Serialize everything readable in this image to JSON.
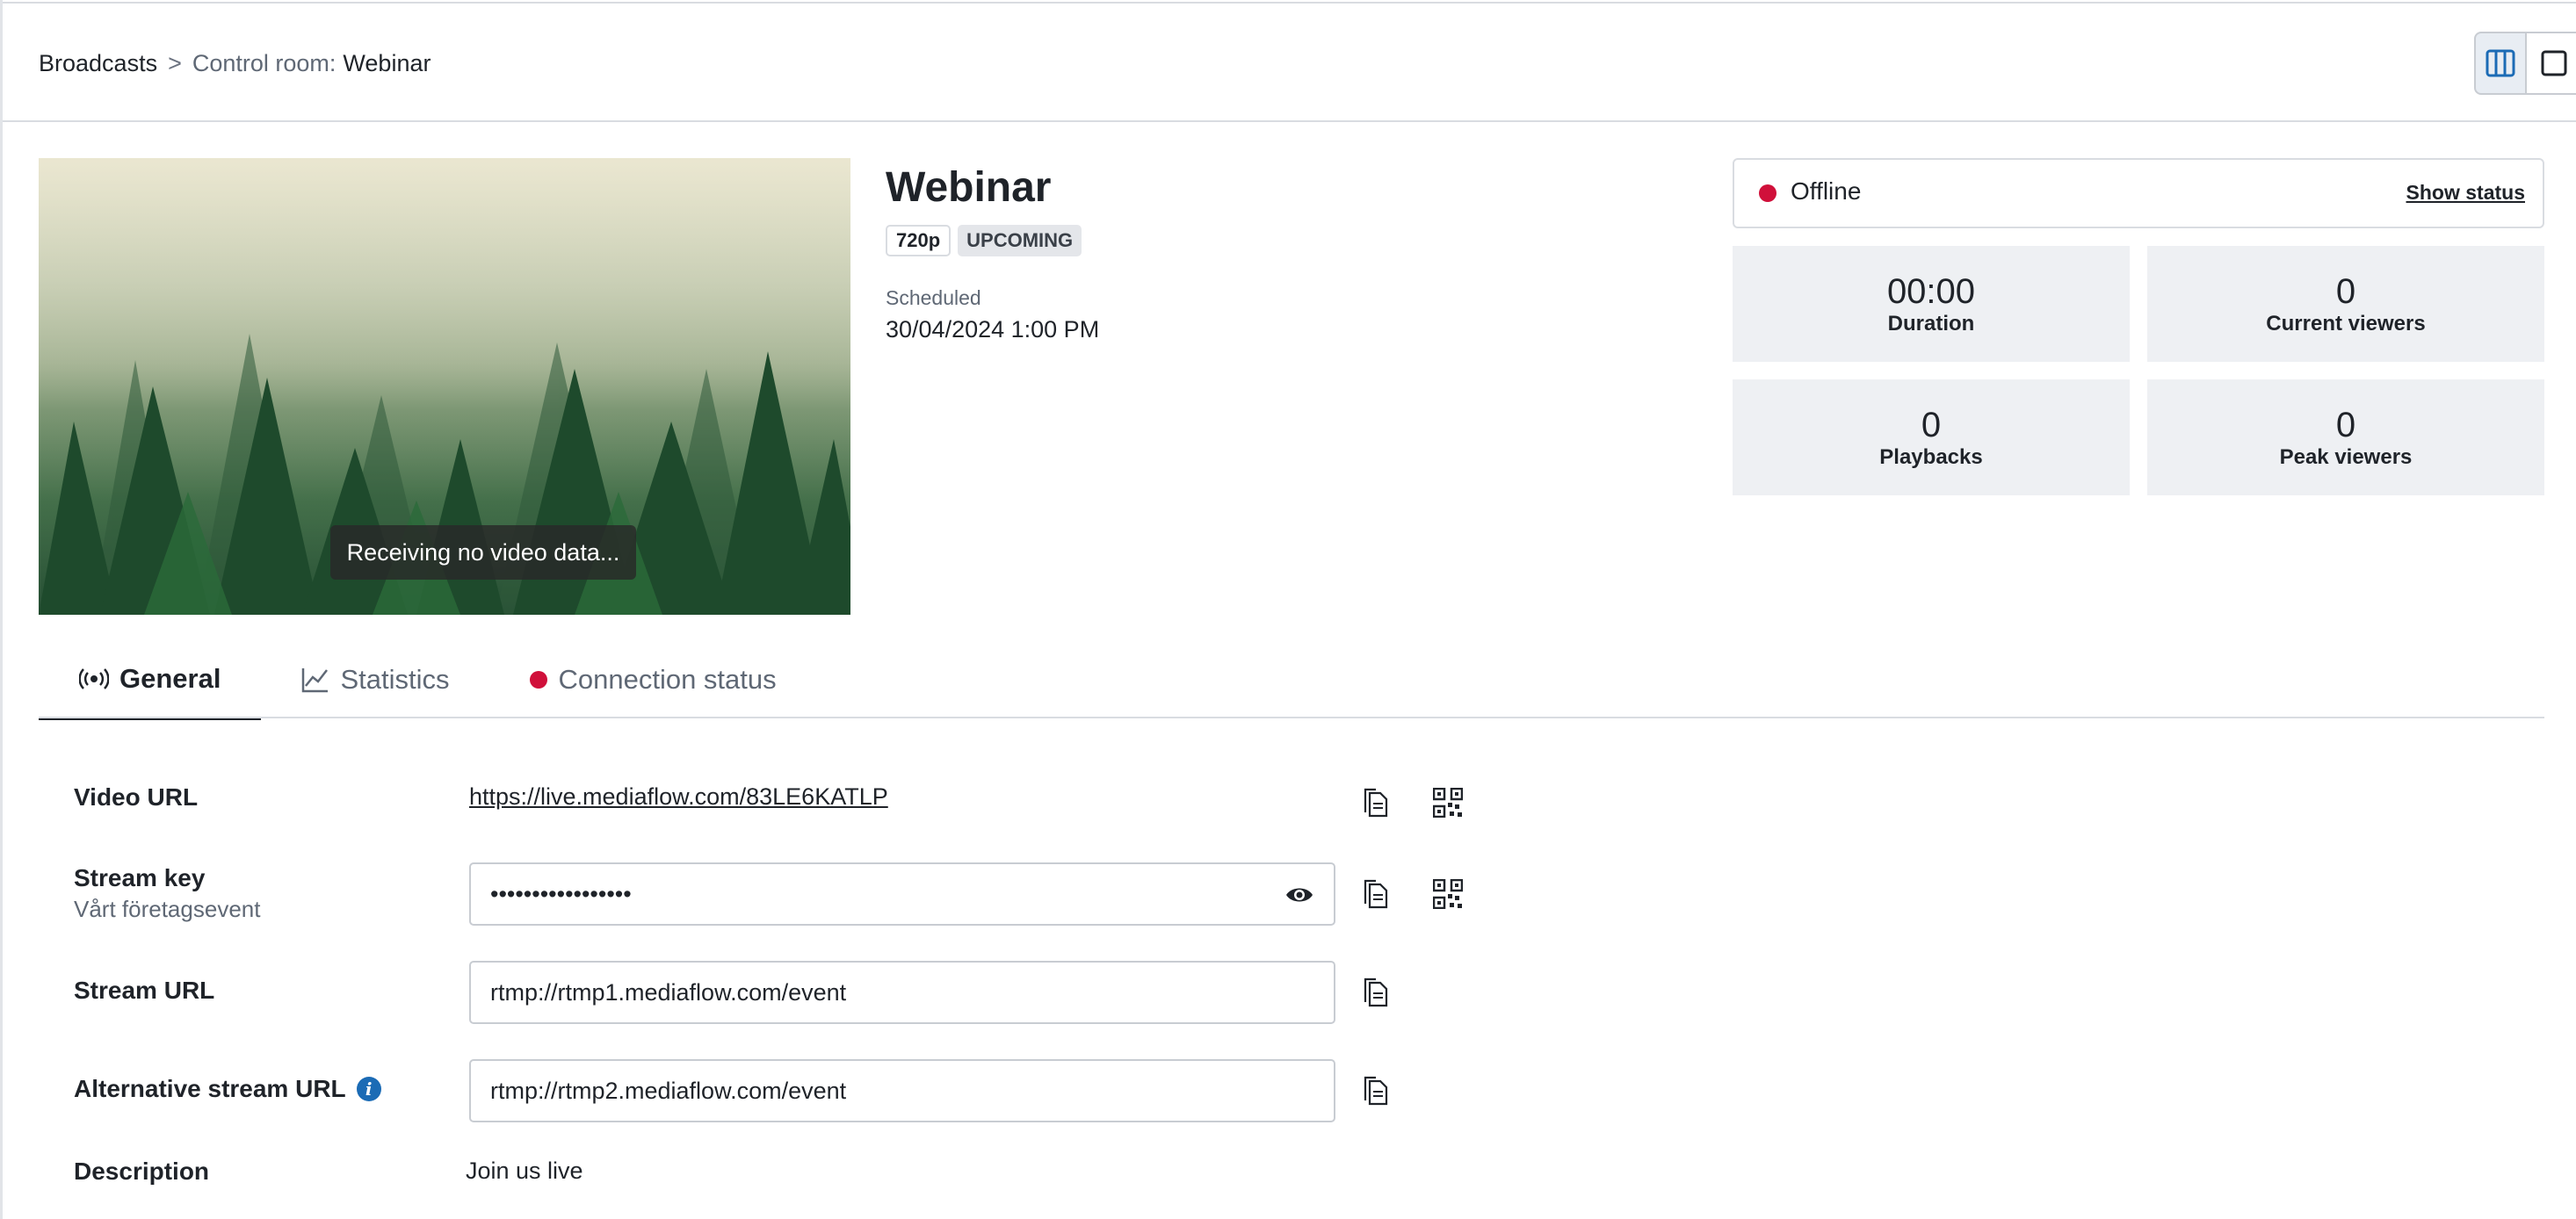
{
  "breadcrumb": {
    "root": "Broadcasts",
    "separator": ">",
    "current_prefix": "Control room:",
    "current_title": "Webinar"
  },
  "preview": {
    "overlay_text": "Receiving no video data..."
  },
  "broadcast": {
    "title": "Webinar",
    "resolution_badge": "720p",
    "status_badge": "UPCOMING",
    "scheduled_label": "Scheduled",
    "scheduled_value": "30/04/2024 1:00 PM"
  },
  "status_panel": {
    "status_text": "Offline",
    "status_color": "#d0103a",
    "show_status_label": "Show status",
    "stats": [
      {
        "value": "00:00",
        "label": "Duration"
      },
      {
        "value": "0",
        "label": "Current viewers"
      },
      {
        "value": "0",
        "label": "Playbacks"
      },
      {
        "value": "0",
        "label": "Peak viewers"
      }
    ]
  },
  "tabs": [
    {
      "label": "General",
      "icon": "broadcast-icon",
      "active": true
    },
    {
      "label": "Statistics",
      "icon": "line-chart-icon",
      "active": false
    },
    {
      "label": "Connection status",
      "icon": "status-dot-icon",
      "active": false
    }
  ],
  "fields": {
    "video_url": {
      "label": "Video URL",
      "value": "https://live.mediaflow.com/83LE6KATLP"
    },
    "stream_key": {
      "label": "Stream key",
      "sublabel": "Vårt företagsevent",
      "value": "•••••••••••••••••"
    },
    "stream_url": {
      "label": "Stream URL",
      "value": "rtmp://rtmp1.mediaflow.com/event"
    },
    "alt_stream_url": {
      "label": "Alternative stream URL",
      "value": "rtmp://rtmp2.mediaflow.com/event"
    },
    "description": {
      "label": "Description",
      "value": "Join us live"
    }
  }
}
